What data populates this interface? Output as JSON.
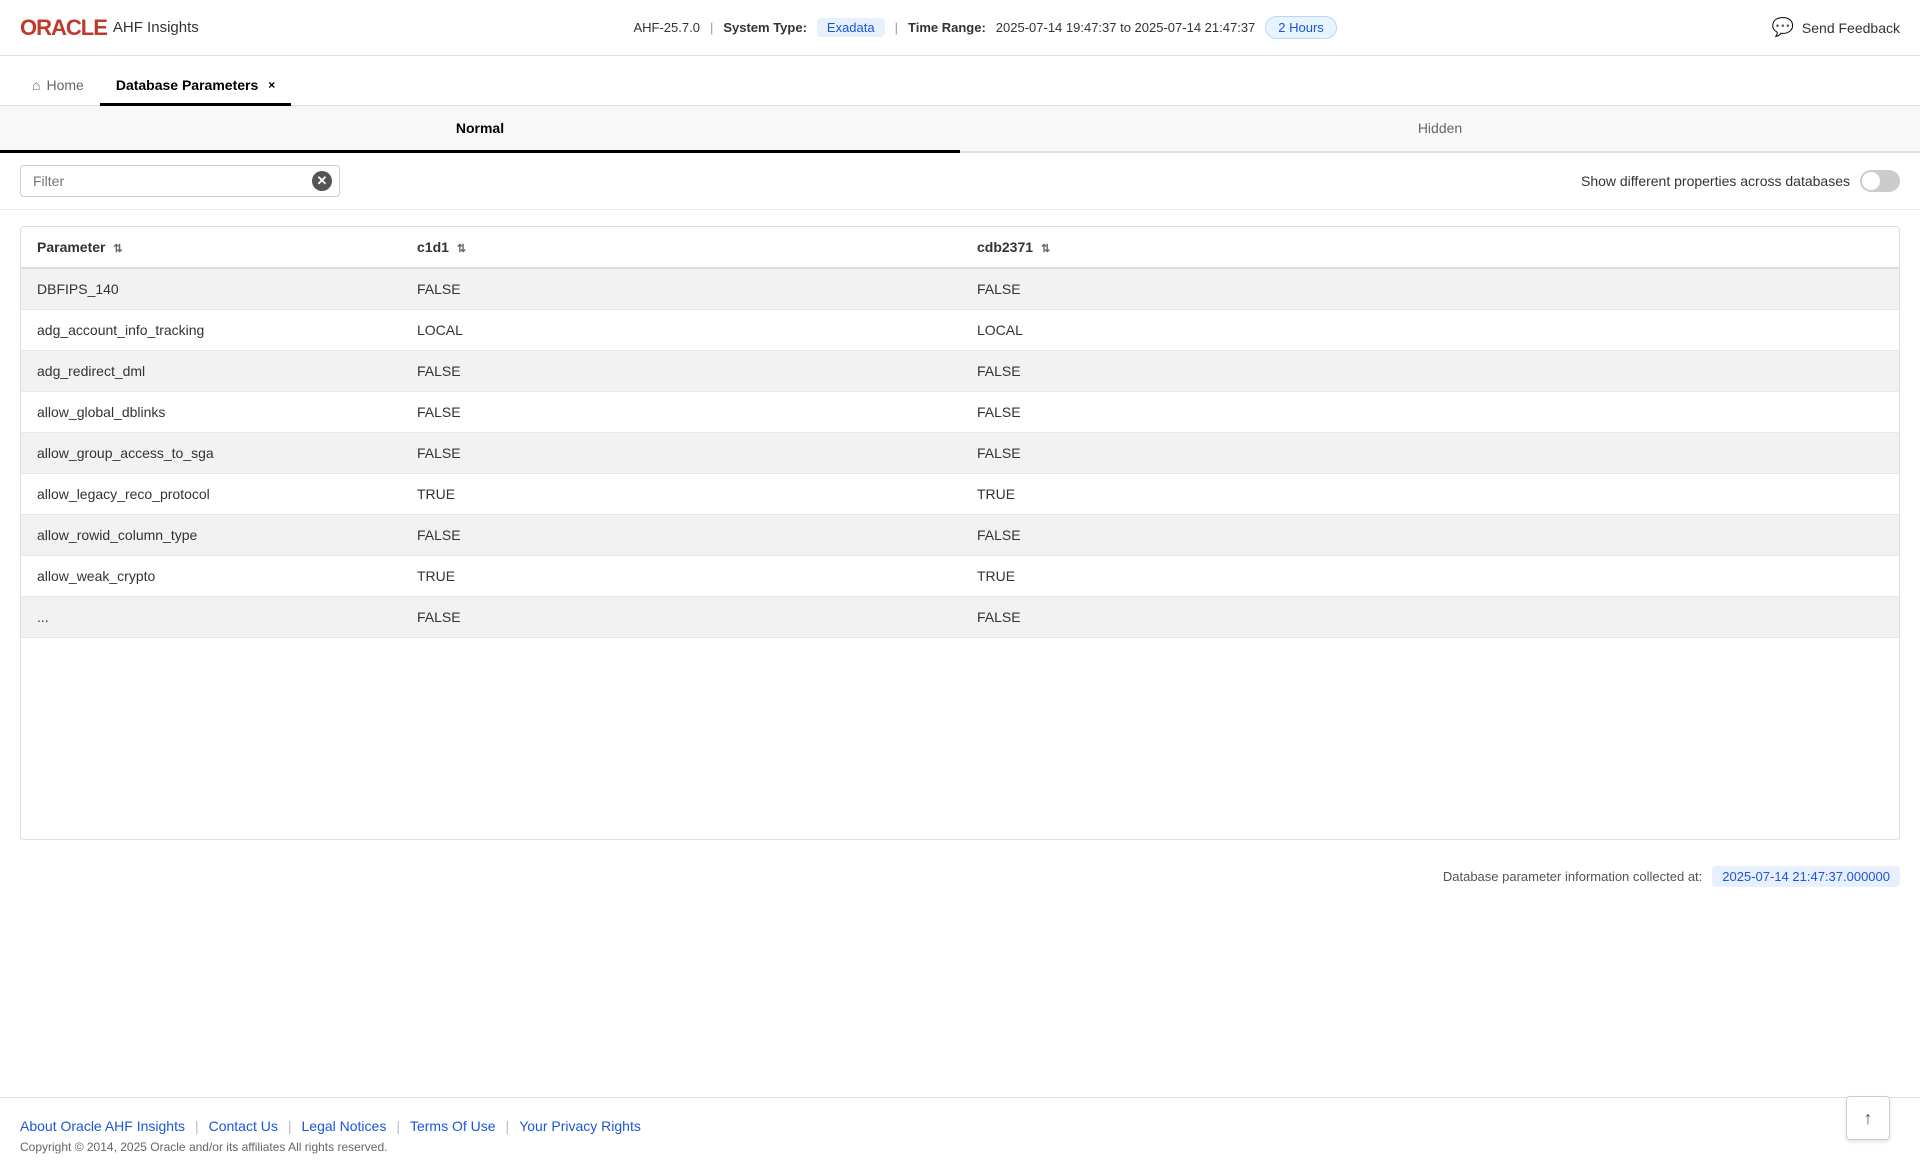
{
  "header": {
    "oracle_text": "ORACLE",
    "app_name": "AHF Insights",
    "version": "AHF-25.7.0",
    "system_type_label": "System Type:",
    "system_type_value": "Exadata",
    "time_range_label": "Time Range:",
    "time_range_value": "2025-07-14 19:47:37 to 2025-07-14 21:47:37",
    "hours_badge": "2 Hours",
    "feedback_label": "Send Feedback"
  },
  "nav": {
    "home_tab": "Home",
    "active_tab": "Database Parameters",
    "active_tab_close": "×"
  },
  "sub_tabs": {
    "normal": "Normal",
    "hidden": "Hidden"
  },
  "filter": {
    "placeholder": "Filter",
    "toggle_label": "Show different properties across databases"
  },
  "table": {
    "columns": [
      {
        "id": "parameter",
        "label": "Parameter",
        "sort": true
      },
      {
        "id": "c1d1",
        "label": "c1d1",
        "sort": true
      },
      {
        "id": "cdb2371",
        "label": "cdb2371",
        "sort": true
      }
    ],
    "rows": [
      {
        "parameter": "DBFIPS_140",
        "c1d1": "FALSE",
        "cdb2371": "FALSE"
      },
      {
        "parameter": "adg_account_info_tracking",
        "c1d1": "LOCAL",
        "cdb2371": "LOCAL"
      },
      {
        "parameter": "adg_redirect_dml",
        "c1d1": "FALSE",
        "cdb2371": "FALSE"
      },
      {
        "parameter": "allow_global_dblinks",
        "c1d1": "FALSE",
        "cdb2371": "FALSE"
      },
      {
        "parameter": "allow_group_access_to_sga",
        "c1d1": "FALSE",
        "cdb2371": "FALSE"
      },
      {
        "parameter": "allow_legacy_reco_protocol",
        "c1d1": "TRUE",
        "cdb2371": "TRUE"
      },
      {
        "parameter": "allow_rowid_column_type",
        "c1d1": "FALSE",
        "cdb2371": "FALSE"
      },
      {
        "parameter": "allow_weak_crypto",
        "c1d1": "TRUE",
        "cdb2371": "TRUE"
      },
      {
        "parameter": "...",
        "c1d1": "FALSE",
        "cdb2371": "FALSE"
      }
    ]
  },
  "db_info": {
    "label": "Database parameter information collected at:",
    "timestamp": "2025-07-14 21:47:37.000000"
  },
  "footer": {
    "links": [
      {
        "label": "About Oracle AHF Insights"
      },
      {
        "label": "Contact Us"
      },
      {
        "label": "Legal Notices"
      },
      {
        "label": "Terms Of Use"
      },
      {
        "label": "Your Privacy Rights"
      }
    ],
    "copyright": "Copyright © 2014, 2025 Oracle and/or its affiliates All rights reserved."
  }
}
